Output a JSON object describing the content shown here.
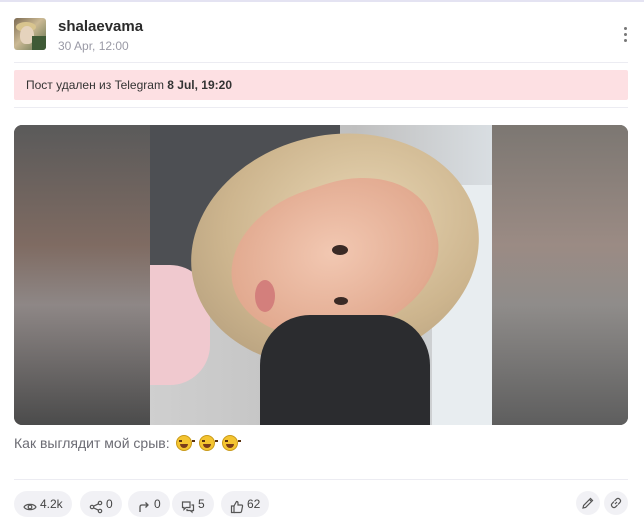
{
  "post": {
    "username": "shalaevama",
    "datetime": "30 Apr, 12:00",
    "deleted_notice": {
      "text": "Пост удален из Telegram",
      "date": "8 Jul, 19:20"
    },
    "caption": "Как выглядит мой срыв:",
    "caption_emojis": [
      "😂",
      "😂",
      "😂"
    ]
  },
  "stats": {
    "views": "4.2k",
    "shares": "0",
    "forwards": "0",
    "comments": "5",
    "reactions": "62"
  },
  "colors": {
    "deleted_bg": "#fde0e3",
    "pill_bg": "#f1f1f5",
    "muted_text": "#9a9aa6"
  },
  "icons": {
    "views": "eye-icon",
    "shares": "share-icon",
    "forwards": "forward-icon",
    "comments": "comments-icon",
    "reactions": "thumbs-up-icon",
    "edit": "pencil-icon",
    "link": "link-icon",
    "menu": "more-vertical-icon"
  }
}
